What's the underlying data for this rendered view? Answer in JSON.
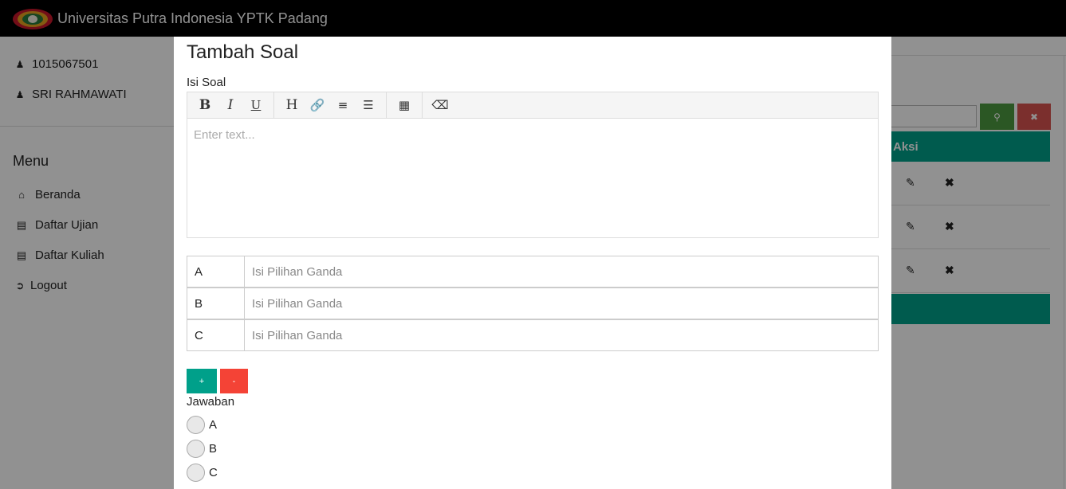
{
  "header": {
    "title": "Universitas Putra Indonesia YPTK Padang",
    "logo_icon": "university-logo"
  },
  "sidebar": {
    "user": [
      {
        "icon": "user-icon",
        "text": "1015067501"
      },
      {
        "icon": "user-icon",
        "text": "SRI RAHMAWATI"
      }
    ],
    "menu_title": "Menu",
    "items": [
      {
        "icon": "home-icon",
        "label": "Beranda"
      },
      {
        "icon": "list-icon",
        "label": "Daftar Ujian"
      },
      {
        "icon": "list-icon",
        "label": "Daftar Kuliah"
      },
      {
        "icon": "logout-icon",
        "label": "Logout"
      }
    ]
  },
  "background_table": {
    "header_action": "Aksi",
    "row_count": 3
  },
  "modal": {
    "title": "Tambah Soal",
    "question_label": "Isi Soal",
    "editor_placeholder": "Enter text...",
    "toolbar": {
      "bold": "B",
      "italic": "I",
      "underline": "U",
      "heading": "H"
    },
    "choices": [
      {
        "key": "A",
        "placeholder": "Isi Pilihan Ganda"
      },
      {
        "key": "B",
        "placeholder": "Isi Pilihan Ganda"
      },
      {
        "key": "C",
        "placeholder": "Isi Pilihan Ganda"
      }
    ],
    "add_button": "+",
    "remove_button": "-",
    "answer_label": "Jawaban",
    "answers": [
      "A",
      "B",
      "C"
    ]
  },
  "colors": {
    "teal": "#00a08a",
    "green": "#4c9a40",
    "red": "#f44336",
    "dark_red": "#d9534f"
  }
}
